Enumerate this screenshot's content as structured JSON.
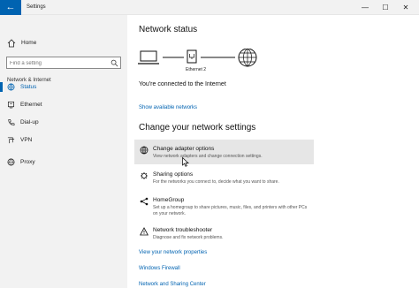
{
  "window": {
    "title": "Settings",
    "back_glyph": "←",
    "min_glyph": "—",
    "max_glyph": "☐",
    "close_glyph": "✕"
  },
  "sidebar": {
    "home_label": "Home",
    "search_placeholder": "Find a setting",
    "section_label": "Network & Internet",
    "items": [
      {
        "label": "Status",
        "icon": "globe-icon",
        "active": true
      },
      {
        "label": "Ethernet",
        "icon": "ethernet-icon",
        "active": false
      },
      {
        "label": "Dial-up",
        "icon": "phone-icon",
        "active": false
      },
      {
        "label": "VPN",
        "icon": "vpn-icon",
        "active": false
      },
      {
        "label": "Proxy",
        "icon": "globe-icon",
        "active": false
      }
    ]
  },
  "main": {
    "network_status_heading": "Network status",
    "adapter_label": "Ethernet 2",
    "connected_text": "You're connected to the Internet",
    "show_networks_link": "Show available networks",
    "change_heading": "Change your network settings",
    "options": [
      {
        "title": "Change adapter options",
        "desc": "View network adapters and change connection settings.",
        "icon": "adapter-globe-icon"
      },
      {
        "title": "Sharing options",
        "desc": "For the networks you connect to, decide what you want to share.",
        "icon": "sharing-icon"
      },
      {
        "title": "HomeGroup",
        "desc": "Set up a homegroup to share pictures, music, files, and printers with other PCs on your network.",
        "icon": "homegroup-icon"
      },
      {
        "title": "Network troubleshooter",
        "desc": "Diagnose and fix network problems.",
        "icon": "warning-icon"
      }
    ],
    "links": {
      "view_properties": "View your network properties",
      "windows_firewall": "Windows Firewall",
      "sharing_center": "Network and Sharing Center"
    }
  },
  "colors": {
    "accent": "#0063b1",
    "sidebar_bg": "#f2f2f2",
    "hover_bg": "#e6e6e6"
  }
}
